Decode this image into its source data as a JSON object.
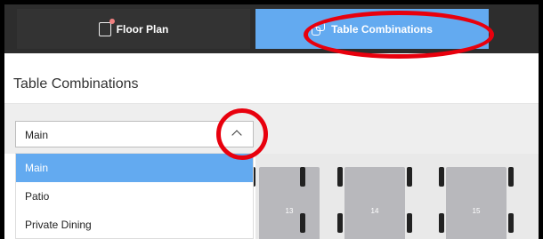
{
  "tabs": [
    {
      "label": "Floor Plan",
      "icon": "floor-plan-icon",
      "active": false
    },
    {
      "label": "Table Combinations",
      "icon": "table-combinations-icon",
      "active": true
    }
  ],
  "page": {
    "title": "Table Combinations"
  },
  "area_select": {
    "value": "Main",
    "options": [
      "Main",
      "Patio",
      "Private Dining"
    ]
  },
  "tables": [
    {
      "number": "13"
    },
    {
      "number": "14"
    },
    {
      "number": "15"
    }
  ],
  "colors": {
    "active_tab": "#63aaf0",
    "selected_option": "#63aaf0",
    "highlight_circle": "#e8000d",
    "table": "#b8b8bc"
  }
}
